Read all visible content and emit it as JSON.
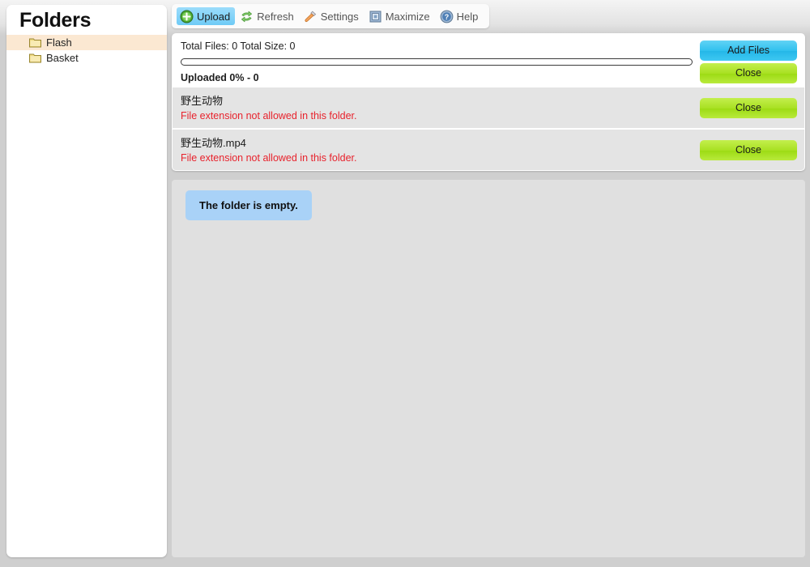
{
  "sidebar": {
    "title": "Folders",
    "items": [
      {
        "label": "Flash",
        "icon": "folder-icon",
        "selected": true
      },
      {
        "label": "Basket",
        "icon": "folder-icon",
        "selected": false
      }
    ]
  },
  "toolbar": {
    "items": [
      {
        "label": "Upload",
        "icon": "upload-plus-icon",
        "active": true
      },
      {
        "label": "Refresh",
        "icon": "refresh-arrows-icon",
        "active": false
      },
      {
        "label": "Settings",
        "icon": "screwdriver-icon",
        "active": false
      },
      {
        "label": "Maximize",
        "icon": "maximize-square-icon",
        "active": false
      },
      {
        "label": "Help",
        "icon": "help-question-icon",
        "active": false
      }
    ]
  },
  "upload_panel": {
    "total_line": "Total Files: 0 Total Size: 0",
    "uploaded_line": "Uploaded 0% - 0",
    "progress_percent": 0,
    "add_files_label": "Add Files",
    "close_label": "Close",
    "files": [
      {
        "name": "野生动物",
        "error": "File extension not allowed in this folder.",
        "close_label": "Close"
      },
      {
        "name": "野生动物.mp4",
        "error": "File extension not allowed in this folder.",
        "close_label": "Close"
      }
    ]
  },
  "content": {
    "empty_message": "The folder is empty."
  },
  "colors": {
    "accent_blue": "#2fc0ee",
    "accent_green": "#a8e021",
    "error_red": "#e8222c",
    "selected_row": "#fbe8d2",
    "info_box": "#a9d2f7",
    "panel_bg": "#e0e0e0"
  }
}
